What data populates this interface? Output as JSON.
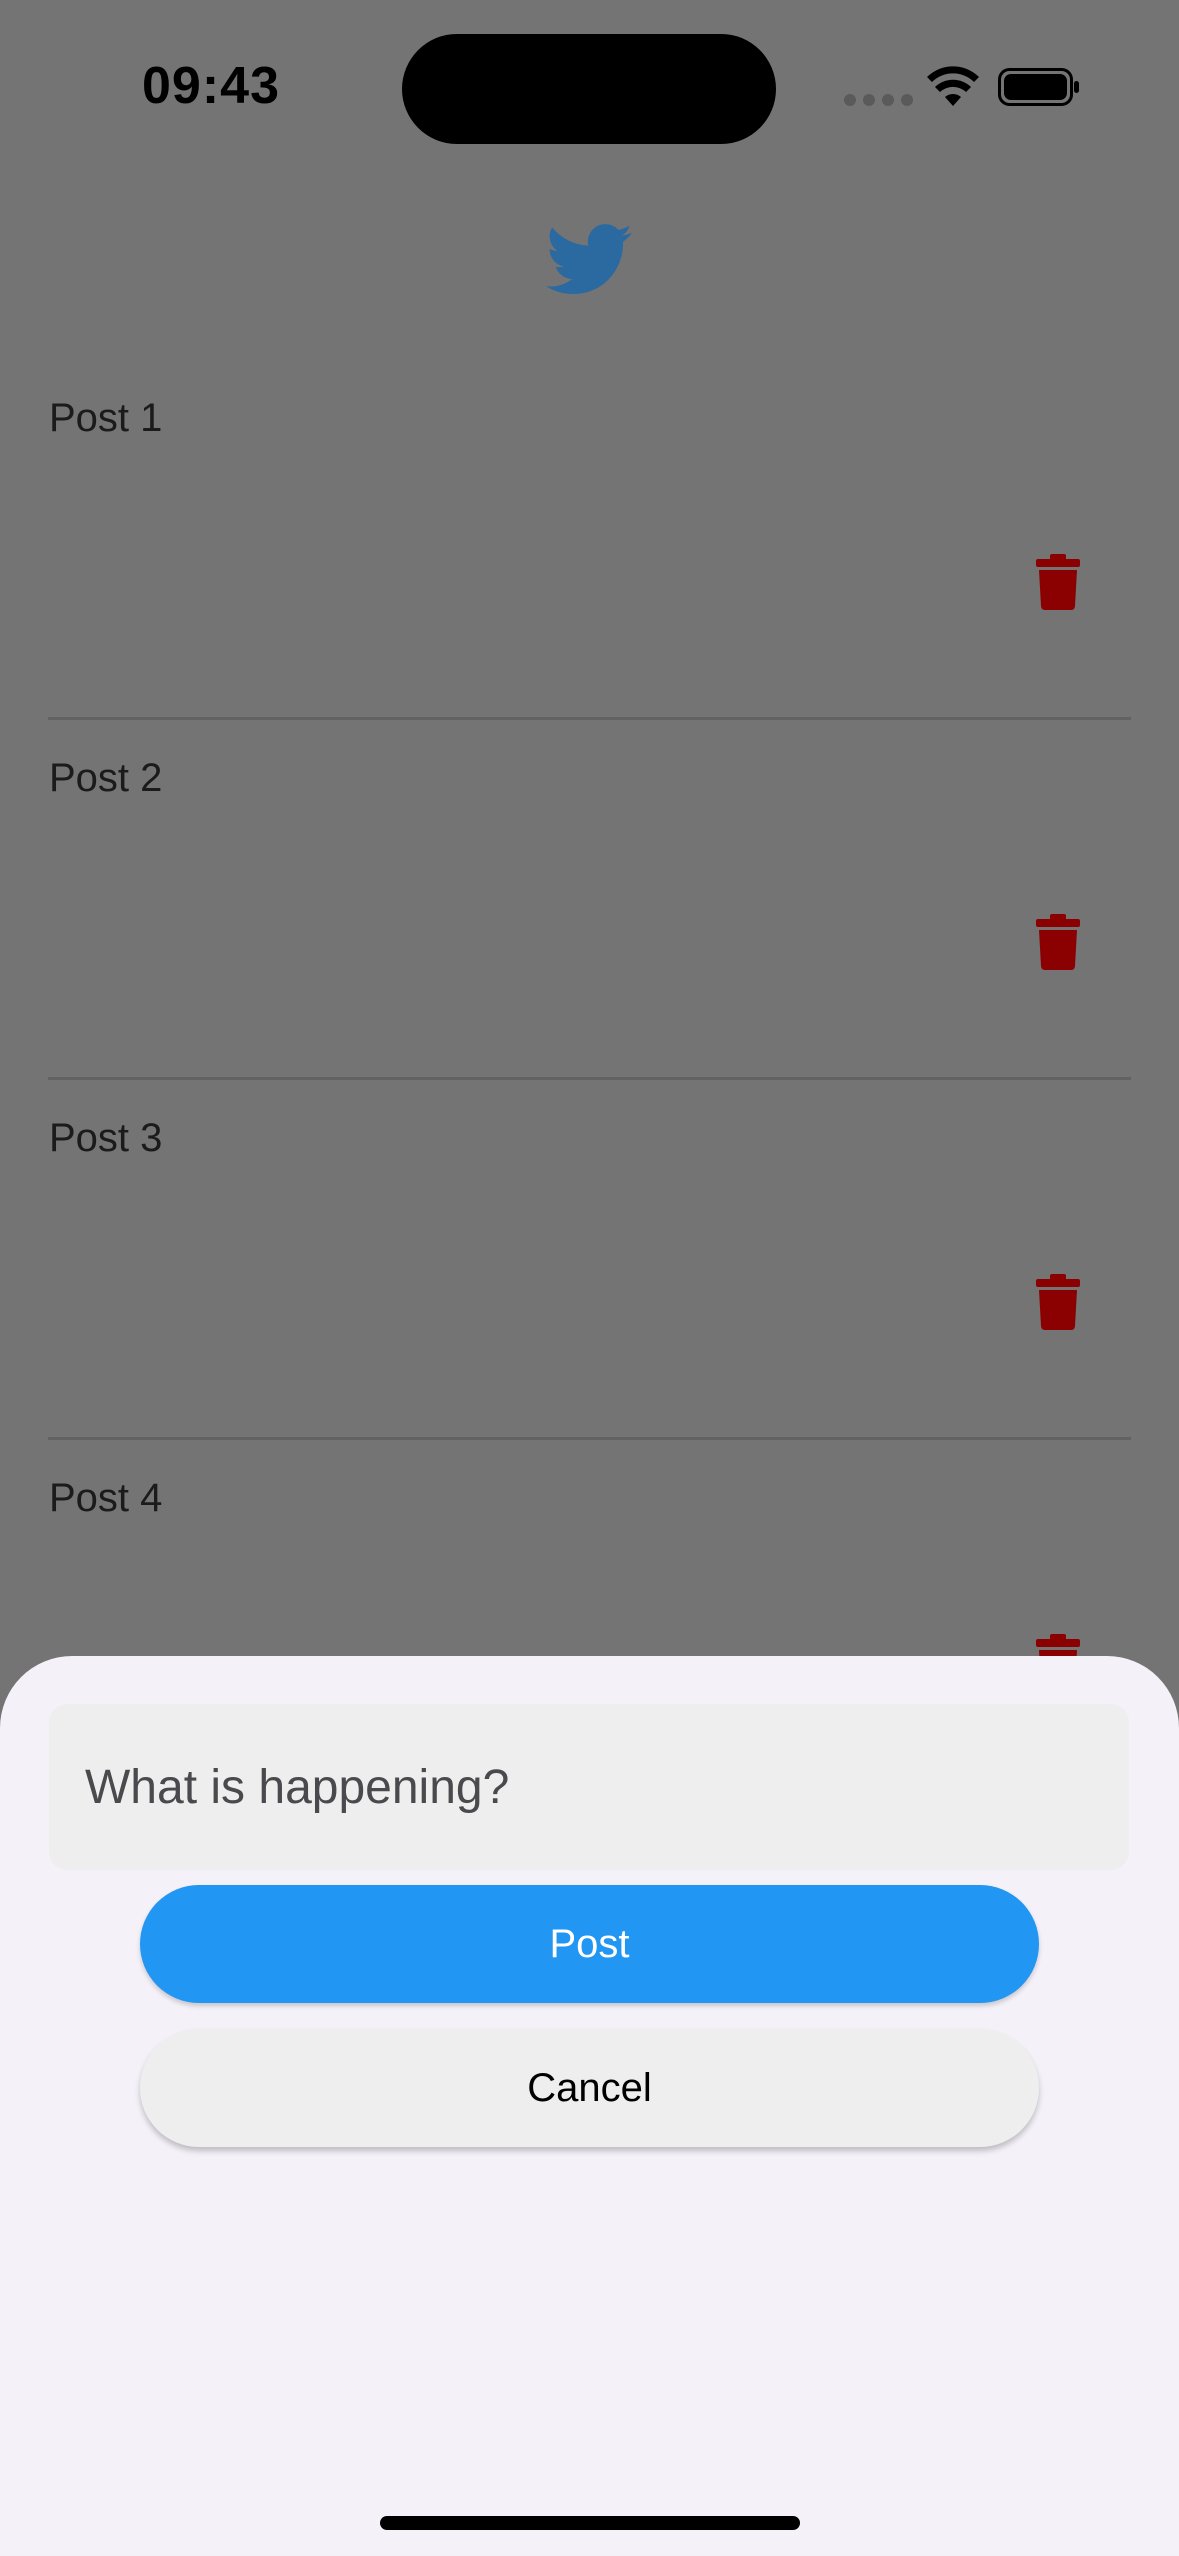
{
  "status_bar": {
    "time": "09:43",
    "icons": [
      "cellular-signal-icon",
      "wifi-icon",
      "battery-icon"
    ]
  },
  "header": {
    "logo_icon": "twitter-bird-icon",
    "logo_color": "#2b6aa0"
  },
  "posts": [
    {
      "title": "Post 1",
      "action_icon": "trash-icon"
    },
    {
      "title": "Post 2",
      "action_icon": "trash-icon"
    },
    {
      "title": "Post 3",
      "action_icon": "trash-icon"
    },
    {
      "title": "Post 4",
      "action_icon": "trash-icon"
    }
  ],
  "colors": {
    "overlay_background": "#747474",
    "delete_icon": "#8b0000",
    "sheet_background": "#f5f1f9",
    "post_button": "#2196f3",
    "cancel_button": "#eeeeee"
  },
  "compose_sheet": {
    "input": {
      "placeholder": "What is happening?",
      "value": ""
    },
    "post_label": "Post",
    "cancel_label": "Cancel"
  }
}
